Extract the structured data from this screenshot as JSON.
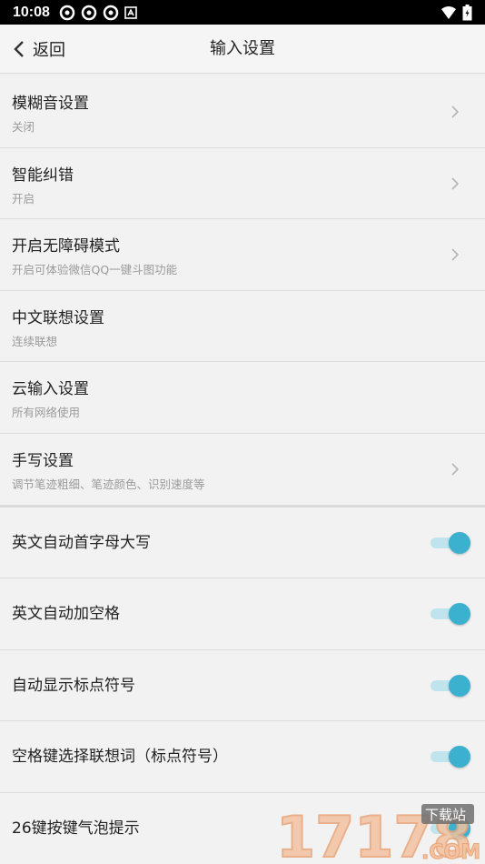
{
  "status": {
    "time": "10:08"
  },
  "header": {
    "back_label": "返回",
    "title": "输入设置"
  },
  "nav_items": [
    {
      "label": "模糊音设置",
      "sub": "关闭"
    },
    {
      "label": "智能纠错",
      "sub": "开启"
    },
    {
      "label": "开启无障碍模式",
      "sub": "开启可体验微信QQ一键斗图功能"
    }
  ],
  "plain_items": [
    {
      "label": "中文联想设置",
      "sub": "连续联想"
    },
    {
      "label": "云输入设置",
      "sub": "所有网络使用"
    }
  ],
  "handwrite": {
    "label": "手写设置",
    "sub": "调节笔迹粗细、笔迹颜色、识别速度等"
  },
  "toggles": [
    {
      "label": "英文自动首字母大写",
      "on": true
    },
    {
      "label": "英文自动加空格",
      "on": true
    },
    {
      "label": "自动显示标点符号",
      "on": true
    },
    {
      "label": "空格键选择联想词（标点符号）",
      "on": true
    },
    {
      "label": "26键按键气泡提示",
      "on": true
    }
  ],
  "watermark": {
    "text": "17178",
    "small": "下载站",
    "domain": ".COM"
  },
  "colors": {
    "accent": "#3cb1cf",
    "track": "#bfe4ee"
  }
}
